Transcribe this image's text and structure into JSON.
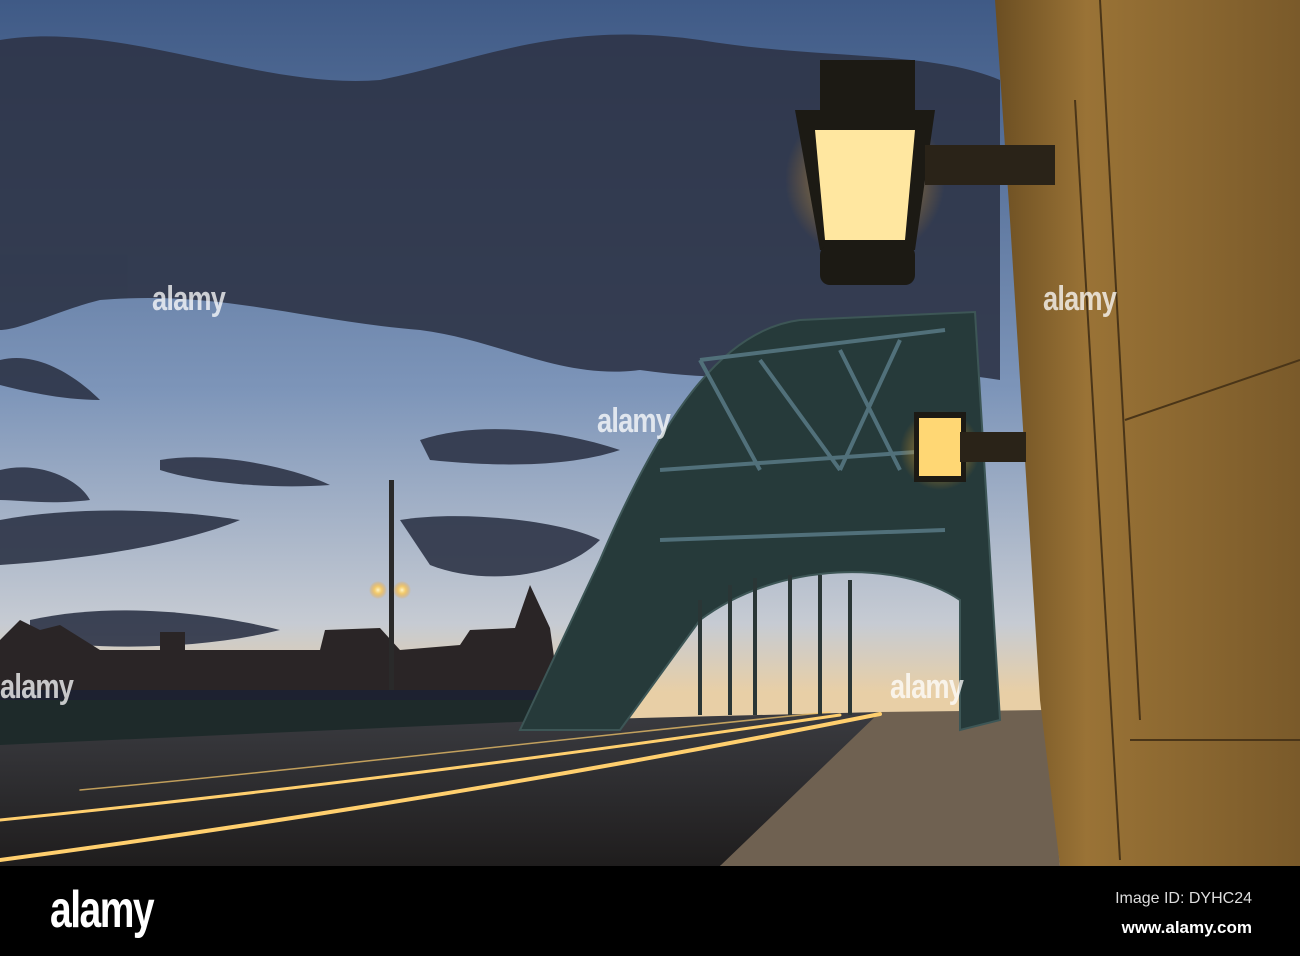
{
  "watermark": {
    "text": "alamy"
  },
  "footer": {
    "logo": "alamy",
    "image_id": "Image ID: DYHC24",
    "url": "www.alamy.com"
  }
}
